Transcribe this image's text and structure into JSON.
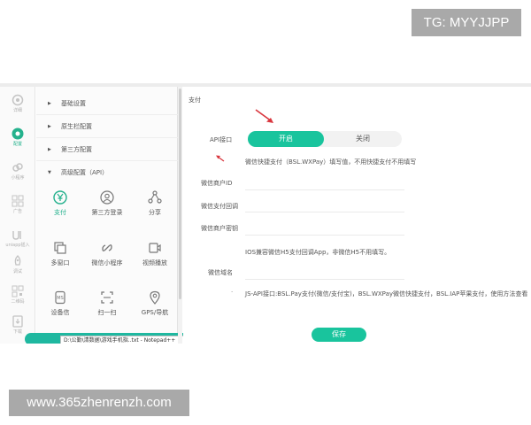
{
  "watermarks": {
    "top": "TG: MYYJJPP",
    "bottom": "www.365zhenrenzh.com"
  },
  "rail": {
    "items": [
      {
        "icon": "cog-icon",
        "label": "详细"
      },
      {
        "icon": "config-icon",
        "label": "配置"
      },
      {
        "icon": "mini-program-icon",
        "label": "小程序"
      },
      {
        "icon": "grid-icon",
        "label": "广告"
      },
      {
        "icon": "uniapp-icon",
        "label": "uniapp插入"
      },
      {
        "icon": "rocket-icon",
        "label": "调试"
      },
      {
        "icon": "qrcode-icon",
        "label": "二维码"
      },
      {
        "icon": "download-icon",
        "label": "下载"
      }
    ]
  },
  "tree": {
    "nodes": [
      {
        "caret": "▶",
        "label": "基础设置"
      },
      {
        "caret": "▶",
        "label": "原生栏配置"
      },
      {
        "caret": "▶",
        "label": "第三方配置"
      },
      {
        "caret": "▼",
        "label": "高级配置（API）"
      }
    ],
    "tools": [
      {
        "icon": "yuan-icon",
        "label": "支付"
      },
      {
        "icon": "user-login-icon",
        "label": "第三方登录"
      },
      {
        "icon": "share-icon",
        "label": "分享"
      },
      {
        "icon": "multi-window-icon",
        "label": "多窗口"
      },
      {
        "icon": "link-icon",
        "label": "微信小程序"
      },
      {
        "icon": "video-icon",
        "label": "视频播放"
      },
      {
        "icon": "device-icon",
        "label": "设备信"
      },
      {
        "icon": "scan-icon",
        "label": "扫一扫"
      },
      {
        "icon": "location-icon",
        "label": "GPS/导航"
      }
    ],
    "tooltip": "D:\\公勤\\清数据\\游戏手机指..txt - Notepad++"
  },
  "content": {
    "title": "支付",
    "api_label": "API接口",
    "toggle": {
      "on": "开启",
      "off": "关闭"
    },
    "wxpay_note": "微信快捷支付（BSL.WXPay）填写值，不用快捷支付不用填写",
    "merchant_id_label": "微信商户ID",
    "callback_label": "微信支付回调",
    "merchant_key_label": "微信商户密钥",
    "ios_note": "IOS兼容微信H5支付回调App，非微信H5不用填写。",
    "domain_label": "微信域名",
    "js_api_note": "JS-API接口:BSL.Pay支付(微信/支付宝)，BSL.WXPay微信快捷支付，BSL.IAP苹果支付，使用方法查看",
    "save_label": "保存"
  },
  "colors": {
    "accent": "#19c49d",
    "arrow": "#d9363e",
    "tooltip_bar": "#1fb8a0"
  }
}
